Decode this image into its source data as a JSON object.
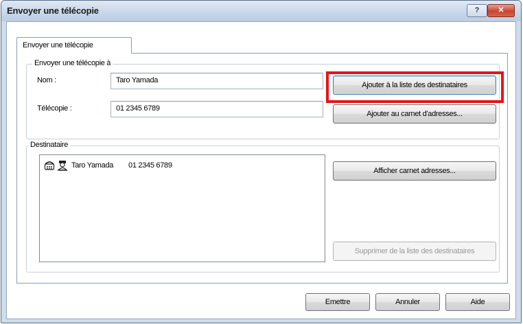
{
  "window": {
    "title": "Envoyer une télécopie",
    "help_glyph": "?",
    "close_glyph": "✕"
  },
  "tab": {
    "label": "Envoyer une télécopie"
  },
  "send_group": {
    "label": "Envoyer une télécopie à",
    "name_label": "Nom :",
    "name_value": "Taro Yamada",
    "fax_label": "Télécopie :",
    "fax_value": "01 2345 6789",
    "add_to_list_button": "Ajouter à la liste des destinataires",
    "add_to_addressbook_button": "Ajouter au carnet d'adresses..."
  },
  "recipient_group": {
    "label": "Destinataire",
    "items": [
      {
        "name": "Taro Yamada",
        "fax": "01 2345 6789",
        "icons": [
          "fax-icon",
          "person-icon"
        ]
      }
    ],
    "show_addressbook_button": "Afficher carnet adresses...",
    "remove_button": "Supprimer de la liste des destinataires"
  },
  "footer": {
    "send_button": "Emettre",
    "cancel_button": "Annuler",
    "help_button": "Aide"
  },
  "colors": {
    "highlight": "#e8121c",
    "title_bar": "#c9d8ea"
  }
}
